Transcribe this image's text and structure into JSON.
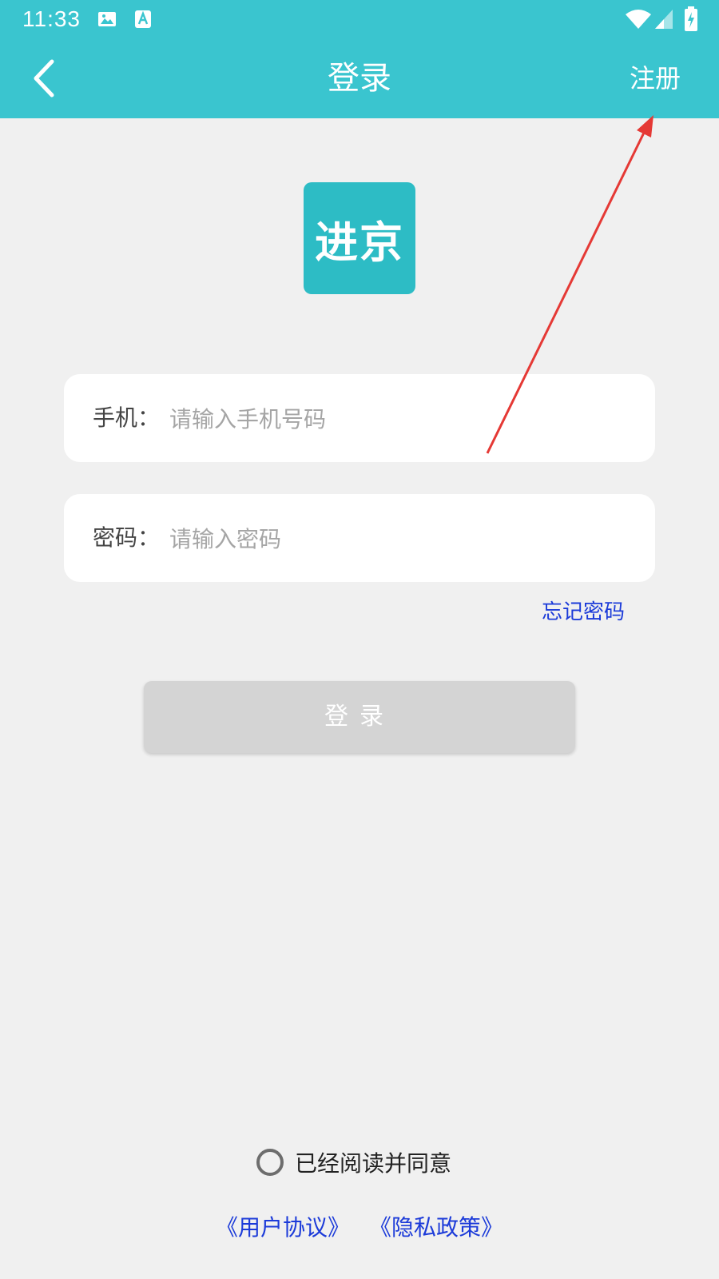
{
  "status_bar": {
    "time": "11:33",
    "icons": [
      "image-icon",
      "text-a-icon",
      "wifi-icon",
      "signal-icon",
      "battery-icon"
    ]
  },
  "app_bar": {
    "title": "登录",
    "register_label": "注册",
    "back_icon": "chevron-left-icon",
    "background": "#3ac5cf"
  },
  "logo": {
    "text": "进京",
    "background": "#2dbcc5"
  },
  "form": {
    "phone_label": "手机：",
    "phone_placeholder": "请输入手机号码",
    "password_label": "密码：",
    "password_placeholder": "请输入密码",
    "forgot_label": "忘记密码",
    "login_label": "登录"
  },
  "agreement": {
    "read_label": "已经阅读并同意",
    "user_agreement": "《用户协议》",
    "privacy_policy": "《隐私政策》"
  },
  "colors": {
    "link": "#1c3bd9",
    "annotation": "#e53935",
    "button_disabled": "#d4d4d4"
  }
}
